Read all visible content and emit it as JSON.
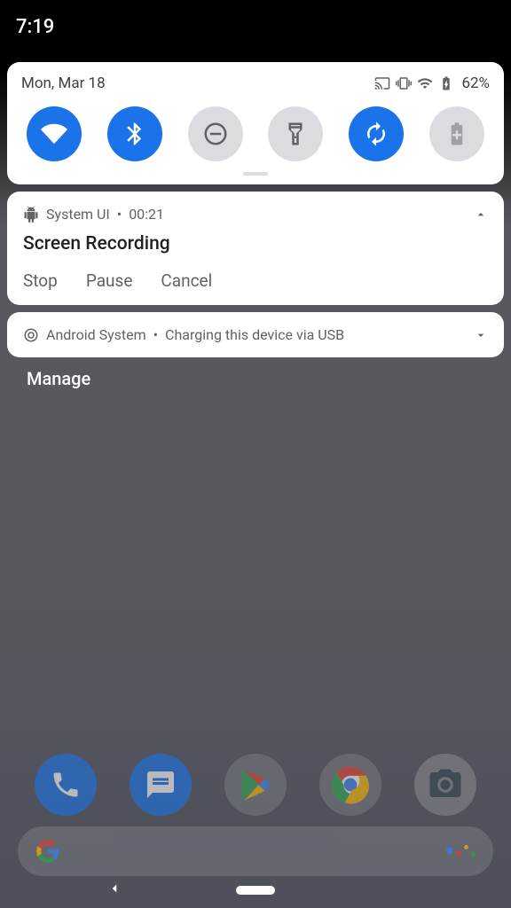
{
  "status_bar": {
    "time": "7:19"
  },
  "quick_settings": {
    "date": "Mon, Mar 18",
    "battery_pct": "62%",
    "tiles": [
      {
        "name": "wifi",
        "active": true
      },
      {
        "name": "bluetooth",
        "active": true
      },
      {
        "name": "dnd",
        "active": false
      },
      {
        "name": "flashlight",
        "active": false
      },
      {
        "name": "rotation",
        "active": true
      },
      {
        "name": "battery-saver",
        "active": false
      }
    ]
  },
  "notifications": [
    {
      "app": "System UI",
      "time": "00:21",
      "title": "Screen Recording",
      "expanded": true,
      "actions": [
        "Stop",
        "Pause",
        "Cancel"
      ]
    },
    {
      "app": "Android System",
      "summary": "Charging this device via USB",
      "expanded": false
    }
  ],
  "manage_label": "Manage",
  "dock": {
    "apps": [
      "phone",
      "messages",
      "play-store",
      "chrome",
      "camera"
    ]
  }
}
